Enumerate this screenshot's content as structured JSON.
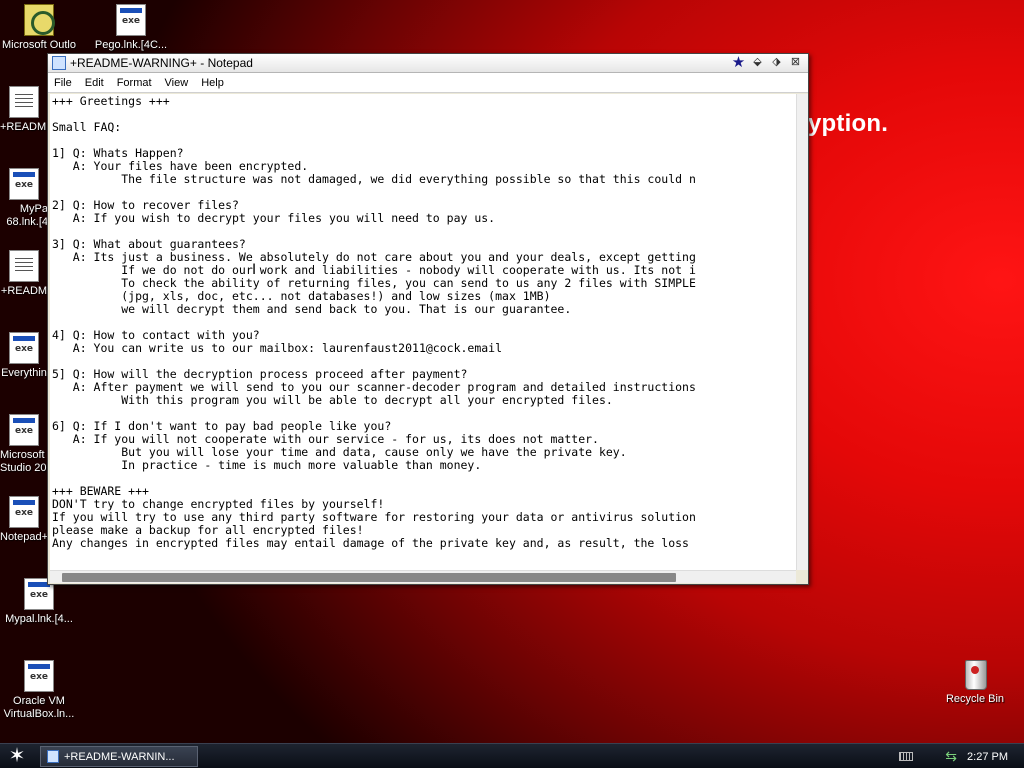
{
  "desktop": {
    "background_text": "yption.",
    "icons": [
      {
        "label": "Microsoft Outlo",
        "icon": "outlook-icon"
      },
      {
        "label": "Pego.lnk.[4C...",
        "icon": "shortcut-app-icon"
      },
      {
        "label": "+README",
        "icon": "text-document-icon"
      },
      {
        "label": "MyPa 68.lnk.[4",
        "icon": "shortcut-app-icon"
      },
      {
        "label": "+READM",
        "icon": "text-document-icon"
      },
      {
        "label": "Everythin",
        "icon": "shortcut-app-icon"
      },
      {
        "label": "Microsoft Studio 20",
        "icon": "shortcut-app-icon"
      },
      {
        "label": "Notepad+",
        "icon": "shortcut-app-icon"
      },
      {
        "label": "Mypal.lnk.[4...",
        "icon": "shortcut-app-icon"
      },
      {
        "label": "Oracle VM VirtualBox.ln...",
        "icon": "shortcut-app-icon"
      },
      {
        "label": "Recycle Bin",
        "icon": "recycle-bin-icon"
      }
    ]
  },
  "window": {
    "title": "+README-WARNING+ - Notepad",
    "title_buttons": [
      "star-icon",
      "minimize-icon",
      "maximize-icon",
      "close-icon"
    ],
    "menu": [
      "File",
      "Edit",
      "Format",
      "View",
      "Help"
    ],
    "content": "+++ Greetings +++\n\nSmall FAQ:\n\n1] Q: Whats Happen?\n   A: Your files have been encrypted.\n          The file structure was not damaged, we did everything possible so that this could n\n\n2] Q: How to recover files?\n   A: If you wish to decrypt your files you will need to pay us.\n\n3] Q: What about guarantees?\n   A: Its just a business. We absolutely do not care about you and your deals, except getting\n          If we do not do our work and liabilities - nobody will cooperate with us. Its not i\n          To check the ability of returning files, you can send to us any 2 files with SIMPLE\n          (jpg, xls, doc, etc... not databases!) and low sizes (max 1MB)\n          we will decrypt them and send back to you. That is our guarantee.\n\n4] Q: How to contact with you?\n   A: You can write us to our mailbox: laurenfaust2011@cock.email\n\n5] Q: How will the decryption process proceed after payment?\n   A: After payment we will send to you our scanner-decoder program and detailed instructions\n          With this program you will be able to decrypt all your encrypted files.\n\n6] Q: If I don't want to pay bad people like you?\n   A: If you will not cooperate with our service - for us, its does not matter.\n          But you will lose your time and data, cause only we have the private key.\n          In practice - time is much more valuable than money.\n\n+++ BEWARE +++\nDON'T try to change encrypted files by yourself!\nIf you will try to use any third party software for restoring your data or antivirus solution\nplease make a backup for all encrypted files!\nAny changes in encrypted files may entail damage of the private key and, as result, the loss"
  },
  "taskbar": {
    "task_label": "+README-WARNIN...",
    "clock": "2:27 PM"
  }
}
